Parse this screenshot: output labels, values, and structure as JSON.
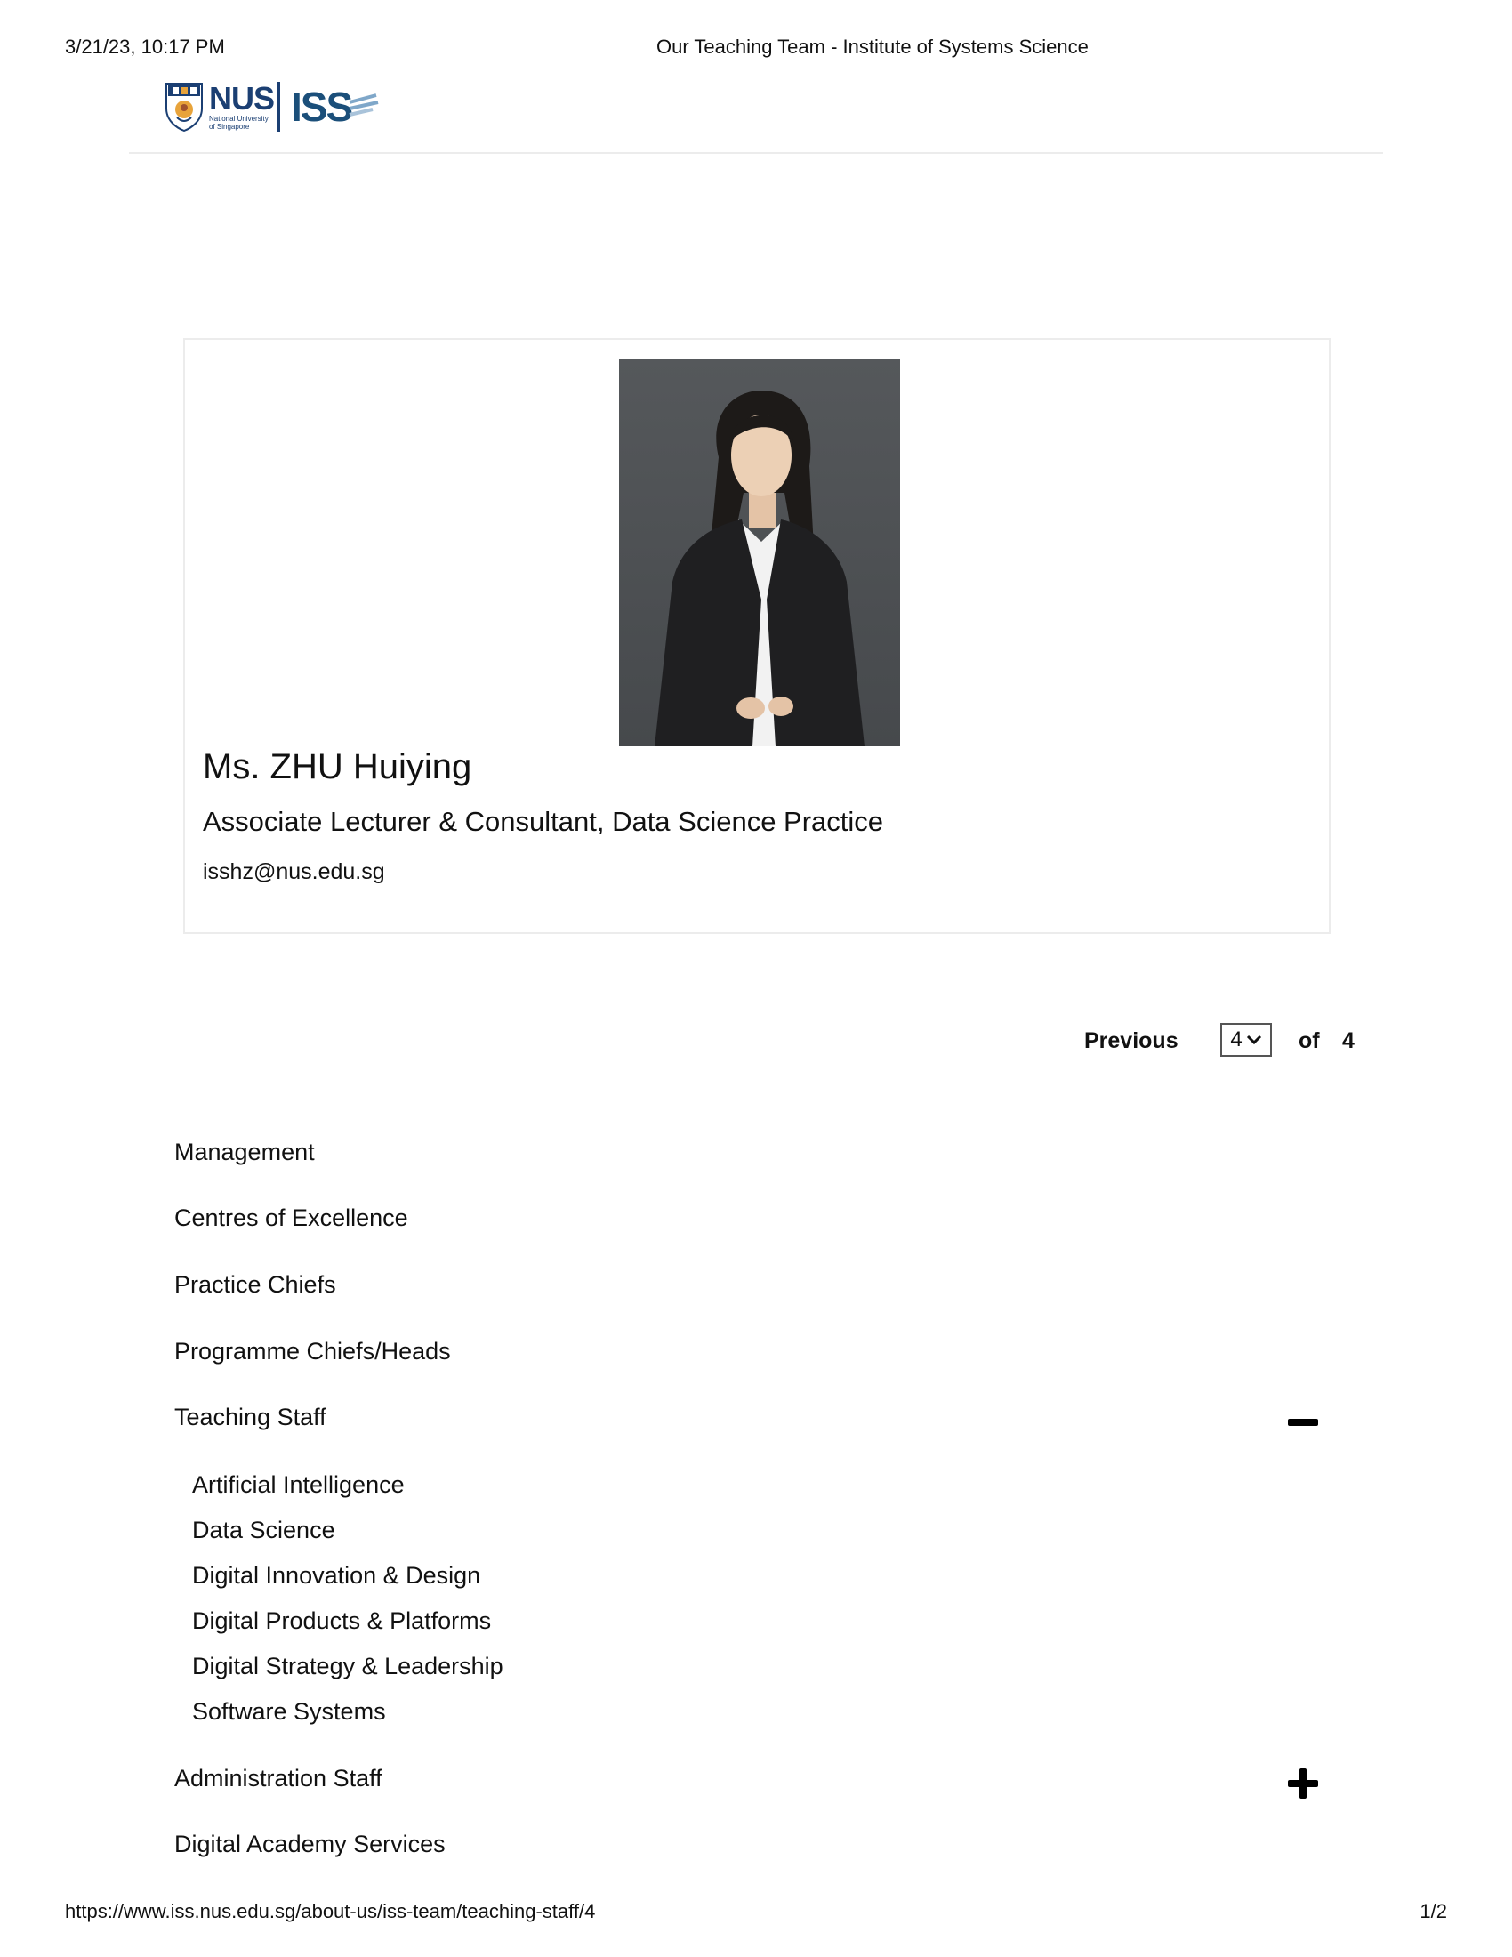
{
  "print_header": {
    "date": "3/21/23, 10:17 PM",
    "title": "Our Teaching Team - Institute of Systems Science"
  },
  "logo": {
    "nus_text": "NUS",
    "nus_subtitle_1": "National University",
    "nus_subtitle_2": "of Singapore",
    "iss_text": "ISS",
    "brand_color": "#1b3f73"
  },
  "profile": {
    "name": "Ms. ZHU Huiying",
    "role": "Associate Lecturer & Consultant, Data Science Practice",
    "email": "isshz@nus.edu.sg"
  },
  "pagination": {
    "previous_label": "Previous",
    "current_page": "4",
    "of_label": "of",
    "total_pages": "4"
  },
  "team_nav": {
    "items": [
      {
        "label": "Management"
      },
      {
        "label": "Centres of Excellence"
      },
      {
        "label": "Practice Chiefs"
      },
      {
        "label": "Programme Chiefs/Heads"
      },
      {
        "label": "Teaching Staff",
        "toggle": "minus-icon"
      },
      {
        "label": "Administration Staff",
        "toggle": "plus-icon"
      },
      {
        "label": "Digital Academy Services"
      }
    ],
    "teaching_staff_subitems": [
      "Artificial Intelligence",
      "Data Science",
      "Digital Innovation & Design",
      "Digital Products & Platforms",
      "Digital Strategy & Leadership",
      "Software Systems"
    ]
  },
  "print_footer": {
    "url": "https://www.iss.nus.edu.sg/about-us/iss-team/teaching-staff/4",
    "page": "1/2"
  }
}
